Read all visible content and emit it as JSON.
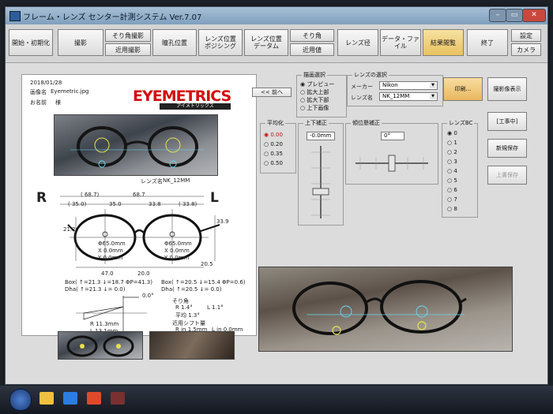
{
  "window": {
    "title": "フレーム・レンズ センター計測システム Ver.7.07"
  },
  "toolbar": {
    "buttons": [
      "開始・初期化",
      "撮影",
      "そり角撮影",
      "近用撮影",
      "瞳孔位置",
      "レンズ位置\nポジシング",
      "レンズ位置\nデータム",
      "そり角",
      "近用値",
      "レンズ径",
      "データ・ファイル",
      "結果閲覧",
      "終了",
      "設定",
      "カメラ"
    ]
  },
  "report": {
    "date": "2018/01/28",
    "filename_label": "画像名",
    "filename": "Eyemetric.jpg",
    "name_label": "お名前",
    "name_suffix": "様",
    "logo": "EYEMETRICS",
    "logo_sub": "アイメトリックス",
    "lens_name_label": "レンズ名",
    "lens_name": "NK_12MM",
    "R": "R",
    "L": "L",
    "dims_top": [
      "( 68.7)",
      "68.7",
      "( 35.0)",
      "35.0",
      "33.8",
      "( 33.8)"
    ],
    "right_dia": "Φ65.0mm",
    "left_dia": "Φ65.0mm",
    "right_x": "X 0.0mm",
    "right_y": "Y 0.0mm",
    "left_x": "X 0.0mm",
    "left_y": "Y 0.0mm",
    "left_h": "21.2",
    "right_h": "33.9",
    "bottom_left": "47.0",
    "bottom_mid": "20.0",
    "bottom_right": "20.5",
    "box_r": "Box( ↑=21.3  ↓=18.7 ΦP=41.3)",
    "dha_r": "Dha( ↑=21.3  ↓= 0.0)",
    "box_l": "Box( ↑=20.5  ↓=15.4 ΦP=0.6)",
    "dha_l": "Dha( ↑=20.5  ↓= 0.0)",
    "angle_top": "0.0°",
    "R_val": "R  11.3mm",
    "L_val": "L  13.1mm",
    "sori_title": "そり角",
    "sori_r": "R    1.4°",
    "sori_l": "L    1.1°",
    "sori_avg": "平均    1.3°",
    "near_title": "近用シフト量",
    "near_r_in": "R in   1.5mm",
    "near_l_in": "L in   0.0mm",
    "near_r_down": "R down  5.7mm",
    "near_l_down": "L down  6.1mm"
  },
  "controls": {
    "prev_button": "<< 前へ",
    "draw_group": "描画選択",
    "draw_options": [
      "プレビュー",
      "拡大上部",
      "拡大下部",
      "上下画像"
    ],
    "lens_group": "レンズの選択",
    "maker_label": "メーカー",
    "maker_value": "Nikon",
    "lens_label": "レンズ名",
    "lens_value": "NK_12MM",
    "print_button": "印刷...",
    "photo_button": "撮影像表示",
    "work_button": "[工事中]",
    "new_save_button": "新規保存",
    "overwrite_button": "上書保存",
    "avg_group": "平均化",
    "avg_options": [
      "0.00",
      "0.20",
      "0.35",
      "0.50"
    ],
    "ud_group": "上下補正",
    "ud_value": "-0.0mm",
    "tilt_group": "傾位懸補正",
    "tilt_value": "0°",
    "bc_group": "レンズBC",
    "bc_options": [
      "0",
      "1",
      "2",
      "3",
      "4",
      "5",
      "6",
      "7",
      "8"
    ]
  }
}
